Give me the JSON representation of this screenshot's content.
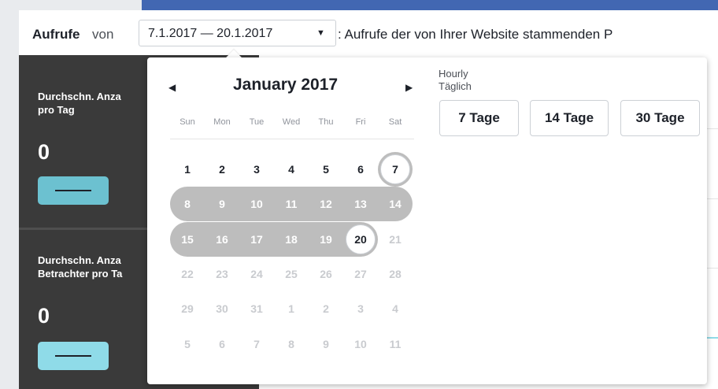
{
  "header": {
    "title": "Aufrufe",
    "von": "von",
    "date_range": "7.1.2017 — 20.1.2017",
    "caret": "▼",
    "description": ": Aufrufe der von Ihrer Website stammenden P"
  },
  "sidebar": {
    "stats": [
      {
        "label": "Durchschn. Anza\npro Tag",
        "value": "0",
        "pill_color": "#6cc1d0"
      },
      {
        "label": "Durchschn. Anza\nBetrachter pro Ta",
        "value": "0",
        "pill_color": "#8fdbe8"
      }
    ]
  },
  "calendar": {
    "month_title": "January 2017",
    "prev_icon": "◀",
    "next_icon": "▶",
    "weekdays": [
      "Sun",
      "Mon",
      "Tue",
      "Wed",
      "Thu",
      "Fri",
      "Sat"
    ],
    "weeks": [
      [
        "1",
        "2",
        "3",
        "4",
        "5",
        "6",
        "7"
      ],
      [
        "8",
        "9",
        "10",
        "11",
        "12",
        "13",
        "14"
      ],
      [
        "15",
        "16",
        "17",
        "18",
        "19",
        "20",
        "21"
      ],
      [
        "22",
        "23",
        "24",
        "25",
        "26",
        "27",
        "28"
      ],
      [
        "29",
        "30",
        "31",
        "1",
        "2",
        "3",
        "4"
      ],
      [
        "5",
        "6",
        "7",
        "8",
        "9",
        "10",
        "11"
      ]
    ],
    "range_start": "7",
    "range_end": "20"
  },
  "granularity": {
    "options": [
      "Hourly",
      "Täglich"
    ]
  },
  "presets": [
    "7 Tage",
    "14 Tage",
    "30 Tage"
  ]
}
